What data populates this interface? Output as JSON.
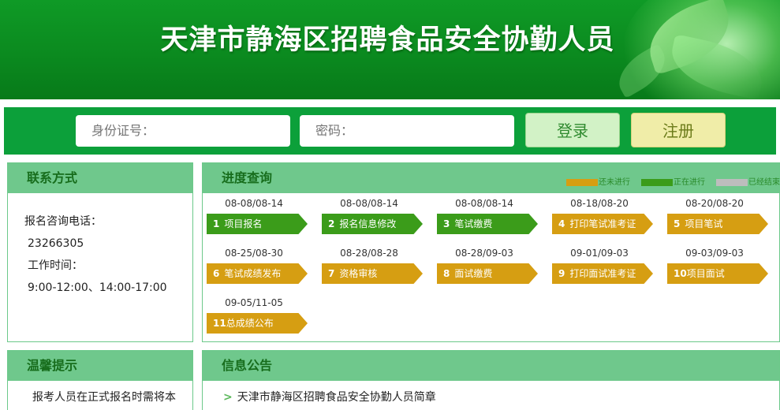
{
  "banner": {
    "title": "天津市静海区招聘食品安全协勤人员"
  },
  "login": {
    "id_placeholder": "身份证号：",
    "password_placeholder": "密码：",
    "login_label": "登录",
    "register_label": "注册"
  },
  "contact": {
    "title": "联系方式",
    "phone_label": "报名咨询电话：",
    "phone": "23266305",
    "hours_label": "工作时间：",
    "hours": "9:00-12:00、14:00-17:00"
  },
  "progress": {
    "title": "进度查询",
    "legend": [
      {
        "label": "还未进行",
        "color": "#d69e12"
      },
      {
        "label": "正在进行",
        "color": "#3b9c1a"
      },
      {
        "label": "已经结束",
        "color": "#bdbdbd"
      }
    ],
    "steps": [
      {
        "num": "1",
        "label": "项目报名",
        "date": "08-08/08-14",
        "status": "正在进行"
      },
      {
        "num": "2",
        "label": "报名信息修改",
        "date": "08-08/08-14",
        "status": "正在进行"
      },
      {
        "num": "3",
        "label": "笔试缴费",
        "date": "08-08/08-14",
        "status": "正在进行"
      },
      {
        "num": "4",
        "label": "打印笔试准考证",
        "date": "08-18/08-20",
        "status": "还未进行"
      },
      {
        "num": "5",
        "label": "项目笔试",
        "date": "08-20/08-20",
        "status": "还未进行"
      },
      {
        "num": "6",
        "label": "笔试成绩发布",
        "date": "08-25/08-30",
        "status": "还未进行"
      },
      {
        "num": "7",
        "label": "资格审核",
        "date": "08-28/08-28",
        "status": "还未进行"
      },
      {
        "num": "8",
        "label": "面试缴费",
        "date": "08-28/09-03",
        "status": "还未进行"
      },
      {
        "num": "9",
        "label": "打印面试准考证",
        "date": "09-01/09-03",
        "status": "还未进行"
      },
      {
        "num": "10",
        "label": "项目面试",
        "date": "09-03/09-03",
        "status": "还未进行"
      },
      {
        "num": "11",
        "label": "总成绩公布",
        "date": "09-05/11-05",
        "status": "还未进行"
      }
    ]
  },
  "tips": {
    "title": "温馨提示",
    "text": "报考人员在正式报名时需将本人"
  },
  "notice": {
    "title": "信息公告",
    "items": [
      {
        "text": "天津市静海区招聘食品安全协勤人员简章"
      }
    ]
  }
}
